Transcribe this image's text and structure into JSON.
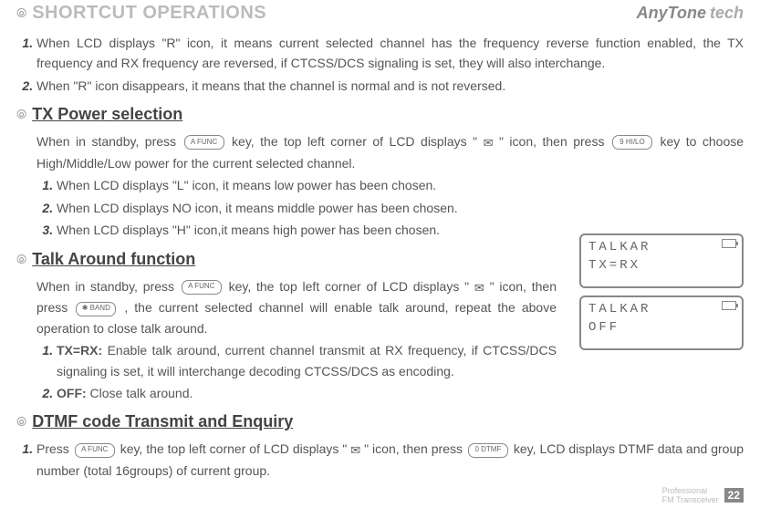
{
  "header": {
    "title": "SHORTCUT OPERATIONS",
    "brand_name": "AnyTone",
    "brand_sub": "tech"
  },
  "intro_items": [
    "When LCD displays \"R\" icon, it means current selected channel has the frequency reverse function enabled, the TX frequency and RX frequency are reversed, if CTCSS/DCS signaling is set, they will also interchange.",
    "When \"R\" icon disappears, it means that the channel is normal and is not reversed."
  ],
  "sec1": {
    "title": "TX Power selection",
    "lead_a": "When in standby, press ",
    "key1": "A FUNC",
    "lead_b": " key, the top left corner of LCD displays \" ",
    "lead_c": " \" icon, then press ",
    "key2": "9 HI/LO",
    "lead_d": " key to choose High/Middle/Low power for the current selected channel.",
    "items": [
      "When LCD displays \"L\" icon, it means low power has been chosen.",
      "When LCD displays NO icon, it means middle power has been chosen.",
      "When LCD displays \"H\" icon,it means high power has been chosen."
    ]
  },
  "sec2": {
    "title": "Talk Around function",
    "lead_a": "When in standby, press ",
    "key1": "A FUNC",
    "lead_b": " key, the top left corner of LCD displays \" ",
    "lead_c": " \" icon, then press ",
    "key2": "✱ BAND",
    "lead_d": ", the current selected channel will enable talk around, repeat the above operation to close talk around.",
    "item1_label": "TX=RX:",
    "item1_text": " Enable talk around, current channel transmit at RX frequency, if CTCSS/DCS signaling is set, it will interchange decoding CTCSS/DCS as encoding.",
    "item2_label": "OFF:",
    "item2_text": " Close talk around.",
    "lcd1_l1": "TALKAR",
    "lcd1_l2": "TX=RX",
    "lcd2_l1": "TALKAR",
    "lcd2_l2": "  OFF"
  },
  "sec3": {
    "title": "DTMF code Transmit and Enquiry",
    "lead_a": "Press ",
    "key1": "A FUNC",
    "lead_b": " key, the top left corner of LCD displays \" ",
    "lead_c": "\" icon, then press ",
    "key2": "0 DTMF",
    "lead_d": " key, LCD displays DTMF data and group number (total 16groups) of current group."
  },
  "foot": {
    "line1": "Professional",
    "line2": "FM Transceiver",
    "page": "22"
  }
}
